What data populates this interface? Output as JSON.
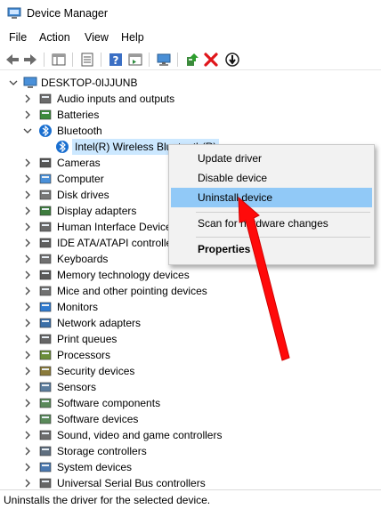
{
  "window": {
    "title": "Device Manager"
  },
  "menu": [
    "File",
    "Action",
    "View",
    "Help"
  ],
  "toolbar": {
    "buttons": [
      "back-arrow-icon",
      "forward-arrow-icon",
      "show-hide-console-tree-icon",
      "properties-icon",
      "help-icon",
      "action-pane-icon",
      "monitor-icon",
      "update-driver-icon",
      "uninstall-x-icon",
      "disable-device-icon"
    ]
  },
  "tree": {
    "root": "DESKTOP-0IJJUNB",
    "categories": [
      {
        "label": "Audio inputs and outputs",
        "icon": "speaker-icon"
      },
      {
        "label": "Batteries",
        "icon": "battery-icon"
      },
      {
        "label": "Bluetooth",
        "icon": "bluetooth-icon",
        "expanded": true
      },
      {
        "label": "Cameras",
        "icon": "camera-icon"
      },
      {
        "label": "Computer",
        "icon": "computer-icon"
      },
      {
        "label": "Disk drives",
        "icon": "disk-drive-icon"
      },
      {
        "label": "Display adapters",
        "icon": "display-adapter-icon"
      },
      {
        "label": "Human Interface Devices",
        "icon": "hid-icon"
      },
      {
        "label": "IDE ATA/ATAPI controllers",
        "icon": "ide-controller-icon"
      },
      {
        "label": "Keyboards",
        "icon": "keyboard-icon"
      },
      {
        "label": "Memory technology devices",
        "icon": "memory-icon"
      },
      {
        "label": "Mice and other pointing devices",
        "icon": "mouse-icon"
      },
      {
        "label": "Monitors",
        "icon": "monitor-icon"
      },
      {
        "label": "Network adapters",
        "icon": "network-adapter-icon"
      },
      {
        "label": "Print queues",
        "icon": "printer-icon"
      },
      {
        "label": "Processors",
        "icon": "processor-icon"
      },
      {
        "label": "Security devices",
        "icon": "security-icon"
      },
      {
        "label": "Sensors",
        "icon": "sensor-icon"
      },
      {
        "label": "Software components",
        "icon": "software-component-icon"
      },
      {
        "label": "Software devices",
        "icon": "software-device-icon"
      },
      {
        "label": "Sound, video and game controllers",
        "icon": "sound-icon"
      },
      {
        "label": "Storage controllers",
        "icon": "storage-controller-icon"
      },
      {
        "label": "System devices",
        "icon": "system-device-icon"
      },
      {
        "label": "Universal Serial Bus controllers",
        "icon": "usb-icon"
      }
    ],
    "bluetooth_child": "Intel(R) Wireless Bluetooth(R)"
  },
  "context_menu": {
    "items": [
      "Update driver",
      "Disable device",
      "Uninstall device",
      "Scan for hardware changes",
      "Properties"
    ],
    "highlighted": "Uninstall device"
  },
  "status": "Uninstalls the driver for the selected device.",
  "colors": {
    "selection": "#cce8ff",
    "menu_highlight": "#91c9f7",
    "arrow": "#ff0a0a"
  }
}
